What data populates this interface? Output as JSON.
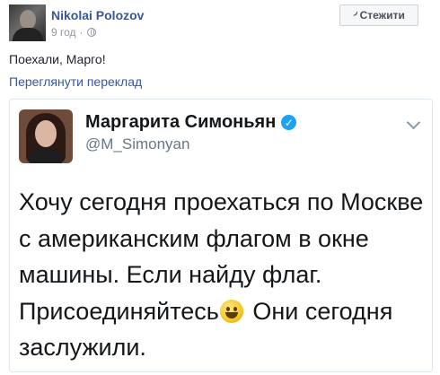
{
  "post": {
    "author": "Nikolai Polozov",
    "time": "9 год",
    "separator": "·",
    "follow_label": "Стежити",
    "text": "Поехали, Марго!",
    "translate_link": "Переглянути переклад"
  },
  "tweet": {
    "name": "Маргарита Симоньян",
    "handle": "@M_Simonyan",
    "lines": [
      "Хочу сегодня проехаться по Москве",
      "с американским флагом в окне",
      "машины. Если найду флаг.",
      "Присоединяйтесь",
      " Они сегодня",
      "заслужили."
    ],
    "emoji": "grinning-face"
  }
}
